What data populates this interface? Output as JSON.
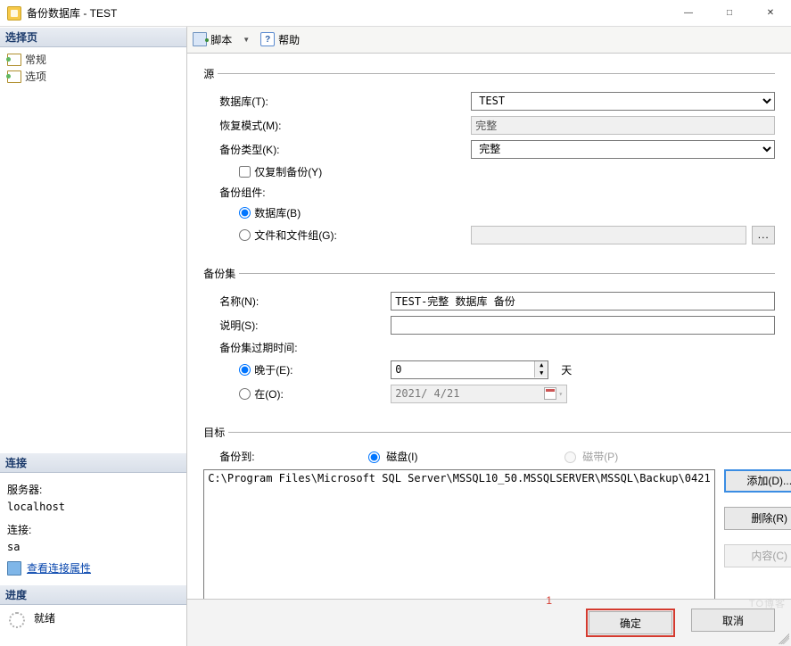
{
  "window": {
    "title": "备份数据库 - TEST"
  },
  "sidebar": {
    "select_page_header": "选择页",
    "pages": [
      {
        "label": "常规"
      },
      {
        "label": "选项"
      }
    ],
    "connection_header": "连接",
    "server_label": "服务器:",
    "server_value": "localhost",
    "connection_label": "连接:",
    "connection_value": "sa",
    "view_props": "查看连接属性",
    "progress_header": "进度",
    "progress_status": "就绪"
  },
  "toolbar": {
    "script": "脚本",
    "help": "帮助"
  },
  "src": {
    "legend": "源",
    "database_label": "数据库(T):",
    "database_value": "TEST",
    "recovery_label": "恢复模式(M):",
    "recovery_value": "完整",
    "type_label": "备份类型(K):",
    "type_value": "完整",
    "copy_only": "仅复制备份(Y)",
    "component_label": "备份组件:",
    "comp_db": "数据库(B)",
    "comp_fg": "文件和文件组(G):"
  },
  "set": {
    "legend": "备份集",
    "name_label": "名称(N):",
    "name_value": "TEST-完整 数据库 备份",
    "desc_label": "说明(S):",
    "desc_value": "",
    "expire_label": "备份集过期时间:",
    "expire_after": "晚于(E):",
    "expire_days_value": "0",
    "expire_days_unit": "天",
    "expire_on": "在(O):",
    "expire_date": "2021/ 4/21"
  },
  "dst": {
    "legend": "目标",
    "backup_to": "备份到:",
    "disk": "磁盘(I)",
    "tape": "磁带(P)",
    "path": "C:\\Program Files\\Microsoft SQL Server\\MSSQL10_50.MSSQLSERVER\\MSSQL\\Backup\\0421",
    "add": "添加(D)...",
    "remove": "删除(R)",
    "contents": "内容(C)"
  },
  "footer": {
    "ok": "确定",
    "cancel": "取消",
    "annotation": "1"
  },
  "watermark": "TO博客"
}
